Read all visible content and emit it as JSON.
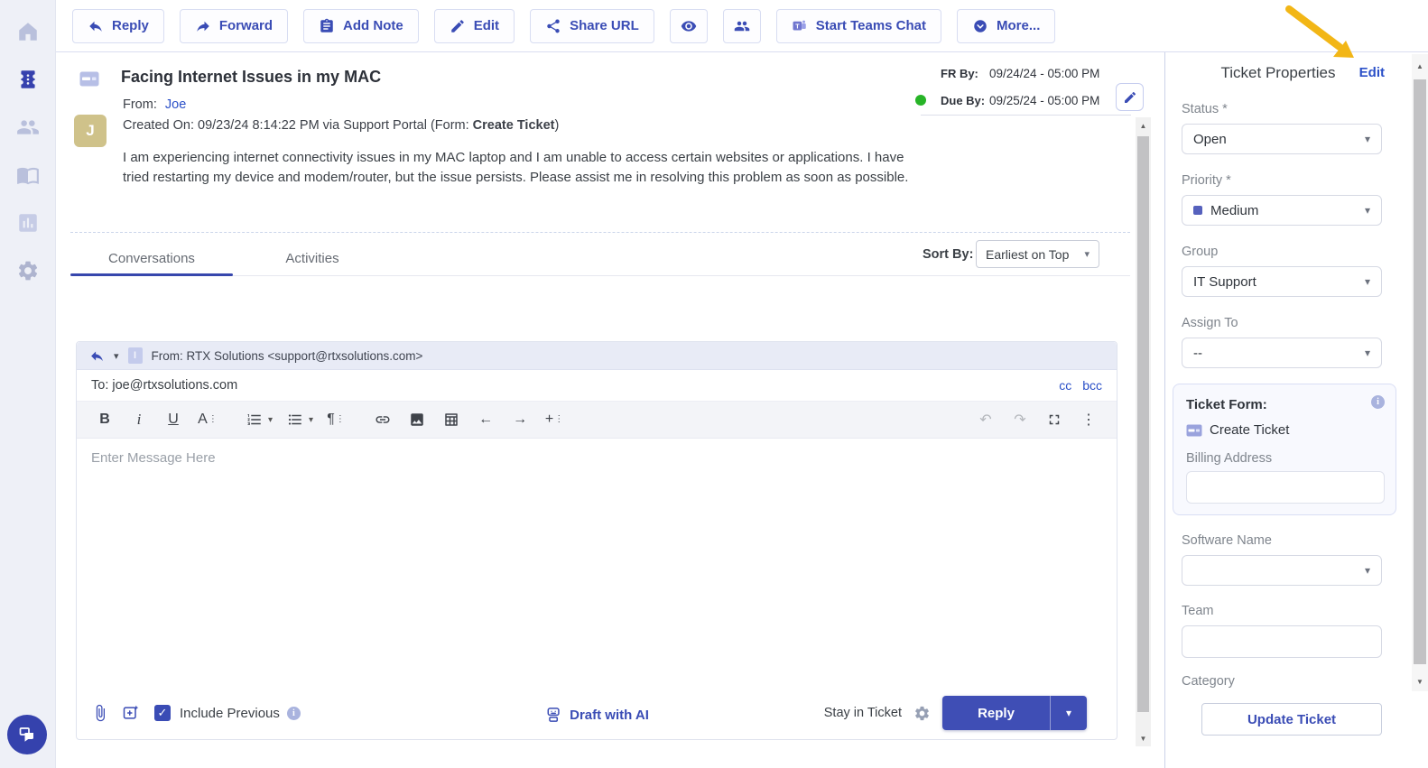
{
  "colors": {
    "accent": "#3a4cb5",
    "reply_button": "#3f4eb5",
    "green_status_dot": "#27b427",
    "annotation_arrow": "#f2b616",
    "avatar_bg": "#cfc28a"
  },
  "icons": {
    "caret_down": "▾",
    "arrow_left": "←",
    "arrow_right": "→",
    "undo": "↶",
    "redo": "↷",
    "dots_vertical": "⋮",
    "check": "✓",
    "scroll_up": "▲",
    "scroll_down": "▼",
    "info": "i",
    "plus": "+"
  },
  "sidebar": {
    "icons": [
      "home-icon",
      "tickets-icon",
      "contacts-icon",
      "knowledge-base-icon",
      "reports-icon",
      "settings-icon"
    ],
    "active": "tickets-icon",
    "chat": "chat-icon"
  },
  "toolbar": {
    "reply": "Reply",
    "forward": "Forward",
    "add_note": "Add Note",
    "edit": "Edit",
    "share_url": "Share URL",
    "start_teams_chat": "Start Teams Chat",
    "more": "More..."
  },
  "ticket": {
    "title": "Facing Internet Issues in my MAC",
    "from_label": "From:",
    "from_name": "Joe",
    "avatar_initial": "J",
    "created_prefix": "Created On: 09/23/24 8:14:22 PM via Support Portal (Form: ",
    "created_form": "Create Ticket",
    "created_suffix": ")",
    "fr_by_label": "FR By:",
    "fr_by_value": "09/24/24 - 05:00 PM",
    "due_by_label": "Due By:",
    "due_by_value": "09/25/24 - 05:00 PM",
    "body": "I am experiencing internet connectivity issues in my MAC laptop and I am unable to access certain websites or applications. I have tried restarting my device and modem/router, but the issue persists. Please assist me in resolving this problem as soon as possible."
  },
  "tabs": {
    "conversations": "Conversations",
    "activities": "Activities",
    "sort_by_label": "Sort By:",
    "sort_by_value": "Earliest on Top"
  },
  "compose": {
    "badge": "I",
    "from_label": "From:",
    "from_value": "RTX Solutions <support@rtxsolutions.com>",
    "to_label": "To:",
    "to_value": "joe@rtxsolutions.com",
    "cc": "cc",
    "bcc": "bcc",
    "toolbar": {
      "bold": "B",
      "italic": "i",
      "underline": "U",
      "font": "A",
      "paragraph": "¶"
    },
    "placeholder": "Enter Message Here",
    "include_previous": "Include Previous",
    "draft_with_ai": "Draft with AI",
    "stay_in_ticket": "Stay in Ticket",
    "reply_button": "Reply"
  },
  "properties": {
    "title": "Ticket Properties",
    "edit_link": "Edit",
    "status_label": "Status *",
    "status_value": "Open",
    "priority_label": "Priority *",
    "priority_value": "Medium",
    "group_label": "Group",
    "group_value": "IT Support",
    "assign_to_label": "Assign To",
    "assign_to_value": "--",
    "ticket_form_label": "Ticket Form:",
    "ticket_form_value": "Create Ticket",
    "billing_address_label": "Billing Address",
    "software_name_label": "Software Name",
    "team_label": "Team",
    "category_label": "Category",
    "update_button": "Update Ticket"
  }
}
